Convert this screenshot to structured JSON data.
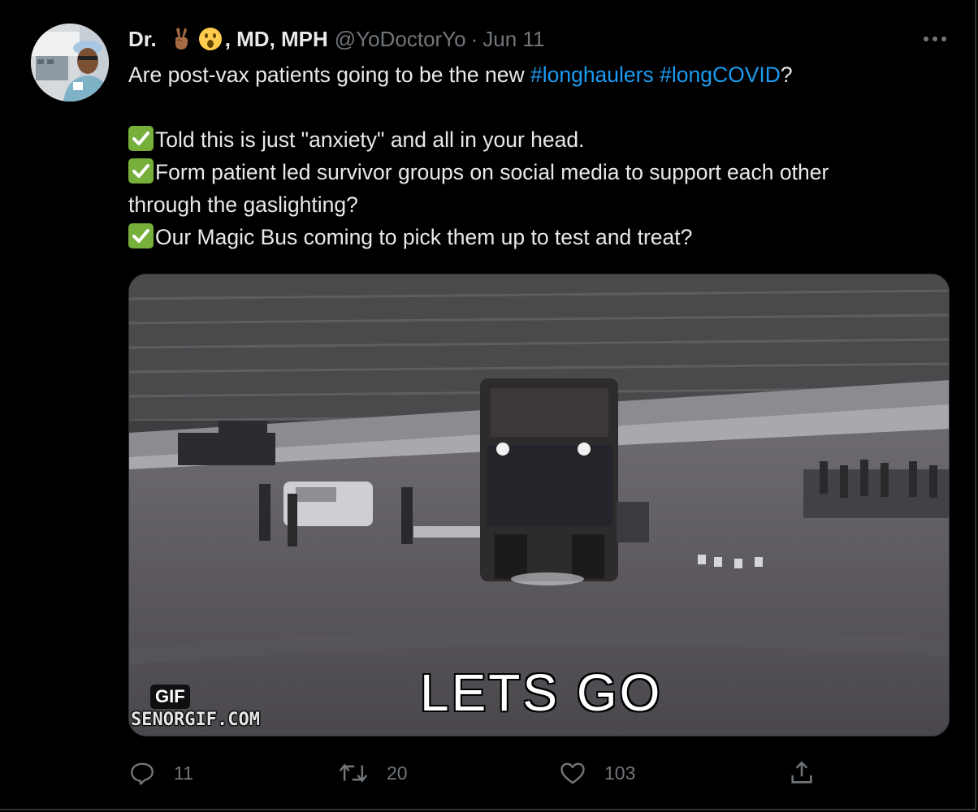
{
  "tweet": {
    "author": {
      "name_prefix": "Dr.",
      "name_suffix": ", MD, MPH",
      "emojis": [
        "victory-hand-emoji",
        "astonished-face-emoji"
      ],
      "handle": "@YoDoctorYo",
      "separator": "·",
      "date": "Jun 11"
    },
    "text": {
      "line1_before": "Are post-vax patients going to be the new ",
      "hashtag1": "#longhaulers",
      "space": " ",
      "hashtag2": "#longCOVID",
      "line1_after": "?",
      "item1": "Told this is just \"anxiety\" and all in your head.",
      "item2_line1": "Form patient led survivor groups on social media to support each other",
      "item2_line2": "through the gaslighting?",
      "item3": "Our Magic Bus coming to pick them up to test and treat?"
    },
    "media": {
      "badge": "GIF",
      "watermark": "SENORGIF.COM",
      "caption": "LETS GO"
    },
    "actions": {
      "reply_count": "11",
      "retweet_count": "20",
      "like_count": "103"
    },
    "colors": {
      "background": "#000000",
      "text": "#e7e9ea",
      "secondary": "#71767b",
      "link": "#1d9bf0",
      "check_emoji": "#76b03b"
    }
  }
}
